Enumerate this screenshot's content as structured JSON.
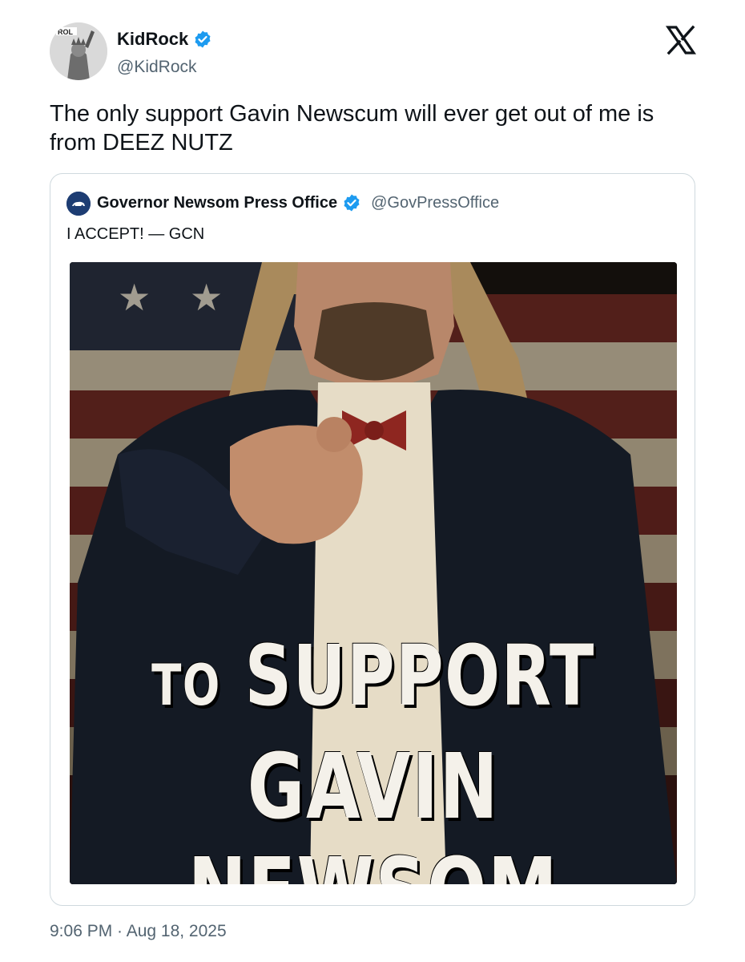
{
  "author": {
    "display_name": "KidRock",
    "handle": "@KidRock",
    "avatar_icon": "statue-of-liberty-avatar",
    "avatar_text": "ROL"
  },
  "tweet": {
    "text": "The only support Gavin Newscum will ever get out of me is from DEEZ NUTZ",
    "timestamp": "9:06 PM · Aug 18, 2025"
  },
  "quoted_tweet": {
    "display_name": "Governor Newsom Press Office",
    "handle": "@GovPressOffice",
    "text": "I ACCEPT! — GCN",
    "avatar_icon": "california-bear-icon",
    "image": {
      "line1_small": "TO",
      "line1_large": "SUPPORT",
      "line2": "GAVIN NEWSOM"
    }
  },
  "icons": {
    "verified": "verified-badge-icon",
    "platform": "x-logo-icon"
  },
  "colors": {
    "verified_blue": "#1d9bf0",
    "secondary_text": "#536471",
    "border": "#cfd9de"
  }
}
